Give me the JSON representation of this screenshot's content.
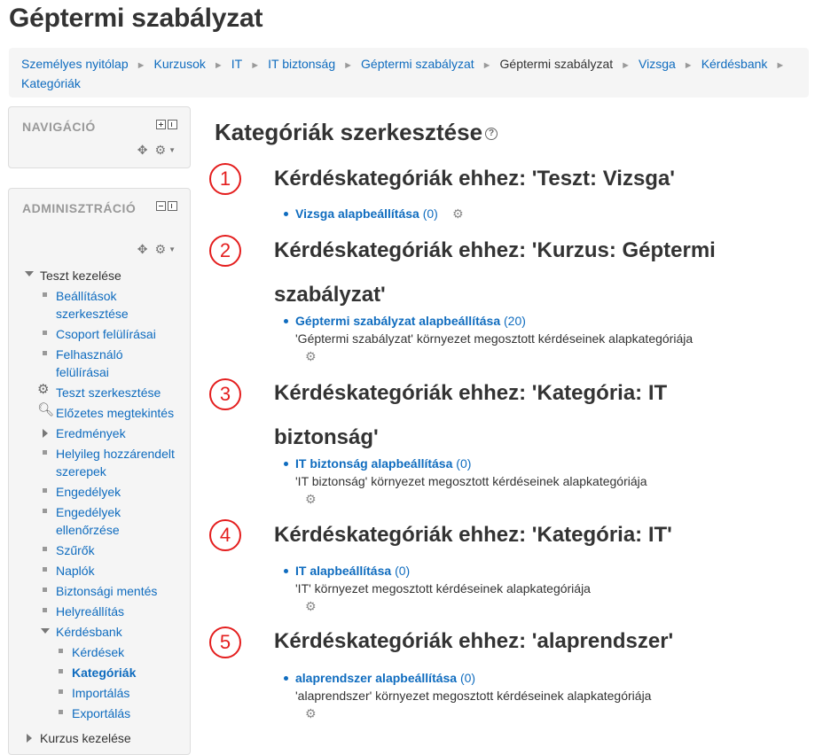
{
  "page": {
    "title": "Géptermi szabályzat"
  },
  "breadcrumb": {
    "items": [
      "Személyes nyitólap",
      "Kurzusok",
      "IT",
      "IT biztonság",
      "Géptermi szabályzat",
      "Géptermi szabályzat",
      "Vizsga",
      "Kérdésbank",
      "Kategóriák"
    ],
    "separator": "►"
  },
  "nav_block": {
    "title": "NAVIGÁCIÓ"
  },
  "admin_block": {
    "title": "ADMINISZTRÁCIÓ",
    "tree": [
      "Teszt kezelése",
      "Beállítások szerkesztése",
      "Csoport felülírásai",
      "Felhasználó felülírásai",
      "Teszt szerkesztése",
      "Előzetes megtekintés",
      "Eredmények",
      "Helyileg hozzárendelt szerepek",
      "Engedélyek",
      "Engedélyek ellenőrzése",
      "Szűrők",
      "Naplók",
      "Biztonsági mentés",
      "Helyreállítás",
      "Kérdésbank",
      "Kérdések",
      "Kategóriák",
      "Importálás",
      "Exportálás",
      "Kurzus kezelése"
    ]
  },
  "main": {
    "heading": "Kategóriák szerkesztése",
    "sections": [
      {
        "num": "1",
        "title": "Kérdéskategóriák ehhez: 'Teszt: Vizsga'",
        "category": "Vizsga alapbeállítása",
        "count": "(0)",
        "desc": ""
      },
      {
        "num": "2",
        "title": "Kérdéskategóriák ehhez: 'Kurzus: Géptermi szabályzat'",
        "category": "Géptermi szabályzat alapbeállítása",
        "count": "(20)",
        "desc": "'Géptermi szabályzat' környezet megosztott kérdéseinek alapkategóriája"
      },
      {
        "num": "3",
        "title": "Kérdéskategóriák ehhez: 'Kategória: IT biztonság'",
        "category": "IT biztonság alapbeállítása",
        "count": "(0)",
        "desc": "'IT biztonság' környezet megosztott kérdéseinek alapkategóriája"
      },
      {
        "num": "4",
        "title": "Kérdéskategóriák ehhez: 'Kategória: IT'",
        "category": "IT alapbeállítása",
        "count": "(0)",
        "desc": "'IT' környezet megosztott kérdéseinek alapkategóriája"
      },
      {
        "num": "5",
        "title": "Kérdéskategóriák ehhez: 'alaprendszer'",
        "category": "alaprendszer alapbeállítása",
        "count": "(0)",
        "desc": "'alaprendszer' környezet megosztott kérdéseinek alapkategóriája"
      }
    ]
  },
  "colors": {
    "link": "#0f6cbf",
    "annotation": "#e41e1e",
    "text": "#333333"
  }
}
